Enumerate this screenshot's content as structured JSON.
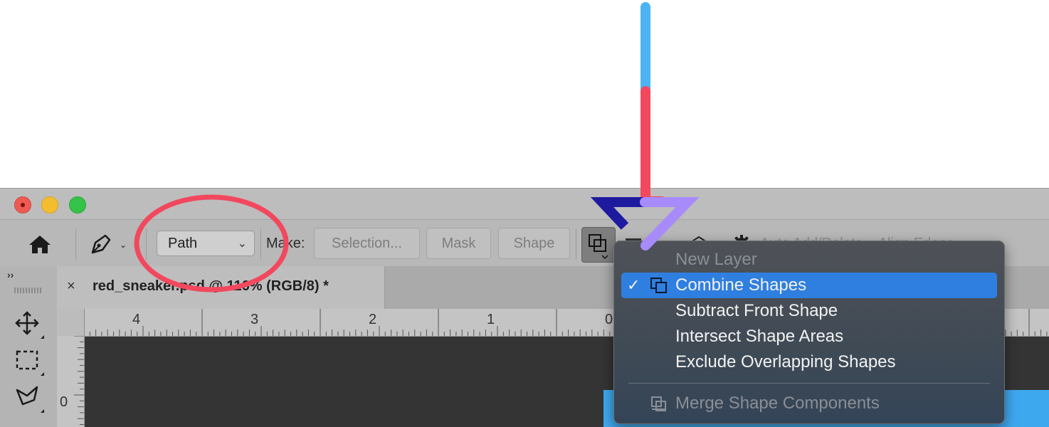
{
  "window": {
    "controls": [
      "close",
      "minimize",
      "maximize"
    ]
  },
  "options_bar": {
    "tool_mode": "Path",
    "make_label": "Make:",
    "make_buttons": [
      "Selection...",
      "Mask",
      "Shape"
    ],
    "auto_add_delete": "Auto Add/Delete",
    "align_edges": "Align Edges"
  },
  "document": {
    "tab_title": "red_sneaker.psd @ 116% (RGB/8) *",
    "tab_close": "×",
    "ruler_h": [
      "4",
      "3",
      "2",
      "1",
      "0"
    ],
    "ruler_v": [
      "0"
    ]
  },
  "toolbox": {
    "collapse": "››"
  },
  "shape_ops_menu": {
    "items": [
      {
        "label": "New Layer",
        "enabled": false,
        "checked": false
      },
      {
        "label": "Combine Shapes",
        "enabled": true,
        "checked": true,
        "highlighted": true
      },
      {
        "label": "Subtract Front Shape",
        "enabled": true,
        "checked": false
      },
      {
        "label": "Intersect Shape Areas",
        "enabled": true,
        "checked": false
      },
      {
        "label": "Exclude Overlapping Shapes",
        "enabled": true,
        "checked": false
      },
      {
        "label": "Merge Shape Components",
        "enabled": false,
        "checked": false
      }
    ],
    "check_glyph": "✓"
  },
  "colors": {
    "highlight": "#2f7fe0",
    "annotation_red": "#f2485e",
    "annotation_blue": "#4cb4f5",
    "annotation_purple": "#a78bfa",
    "annotation_navy": "#1e1aa0"
  }
}
